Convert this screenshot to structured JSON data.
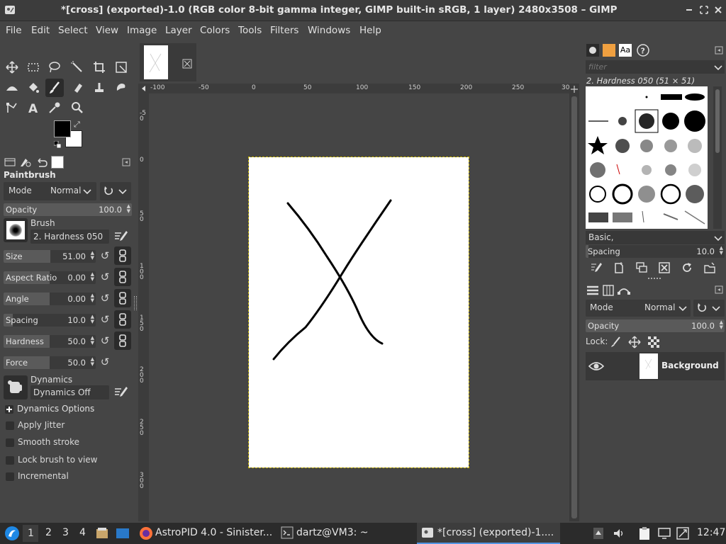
{
  "window": {
    "title": "*[cross] (exported)-1.0 (RGB color 8-bit gamma integer, GIMP built-in sRGB, 1 layer) 2480x3508 – GIMP"
  },
  "menu": [
    "File",
    "Edit",
    "Select",
    "View",
    "Image",
    "Layer",
    "Colors",
    "Tools",
    "Filters",
    "Windows",
    "Help"
  ],
  "tool_options": {
    "tool_name": "Paintbrush",
    "mode_label": "Mode",
    "mode_value": "Normal",
    "opacity": {
      "label": "Opacity",
      "value": "100.0",
      "fraction": 1.0
    },
    "brush_label": "Brush",
    "brush_name": "2. Hardness 050",
    "size": {
      "label": "Size",
      "value": "51.00",
      "fraction": 0.51
    },
    "aspect_ratio": {
      "label": "Aspect Ratio",
      "value": "0.00",
      "fraction": 0.5
    },
    "angle": {
      "label": "Angle",
      "value": "0.00",
      "fraction": 0.5
    },
    "spacing": {
      "label": "Spacing",
      "value": "10.0",
      "fraction": 0.1
    },
    "hardness": {
      "label": "Hardness",
      "value": "50.0",
      "fraction": 0.5
    },
    "force": {
      "label": "Force",
      "value": "50.0",
      "fraction": 0.5
    },
    "dynamics_label": "Dynamics",
    "dynamics_value": "Dynamics Off",
    "dynamics_options": "Dynamics Options",
    "apply_jitter": "Apply Jitter",
    "smooth_stroke": "Smooth stroke",
    "lock_brush": "Lock brush to view",
    "incremental": "Incremental"
  },
  "ruler": {
    "h_labels": [
      "-100",
      "-50",
      "0",
      "50",
      "100",
      "150",
      "200",
      "250",
      "30"
    ],
    "v_labels": [
      "-50",
      "0",
      "50",
      "100",
      "150",
      "200",
      "250",
      "300"
    ]
  },
  "brushes": {
    "filter_placeholder": "filter",
    "current": "2. Hardness 050 (51 × 51)",
    "tag_value": "Basic,",
    "spacing_label": "Spacing",
    "spacing_value": "10.0"
  },
  "layers": {
    "mode_label": "Mode",
    "mode_value": "Normal",
    "opacity_label": "Opacity",
    "opacity_value": "100.0",
    "lock_label": "Lock:",
    "layer_name": "Background"
  },
  "taskbar": {
    "workspaces": [
      "1",
      "2",
      "3",
      "4"
    ],
    "firefox_task": "AstroPID 4.0 - Sinister...",
    "terminal_task": "dartz@VM3: ~",
    "gimp_task": "*[cross] (exported)-1....",
    "clock": "12:47"
  },
  "colors": {
    "foreground": "#000000",
    "background": "#ffffff",
    "accent": "#5294e2"
  }
}
